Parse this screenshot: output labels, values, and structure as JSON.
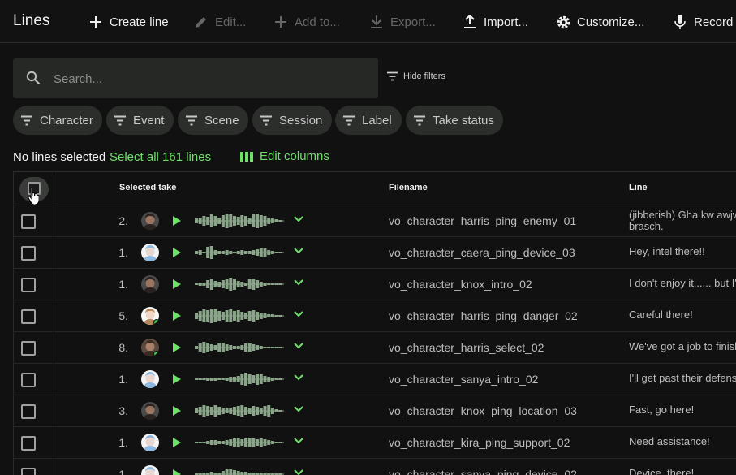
{
  "app": {
    "title": "Lines"
  },
  "toolbar": {
    "create_line": "Create line",
    "edit": "Edit...",
    "add_to": "Add to...",
    "export": "Export...",
    "import": "Import...",
    "customize": "Customize...",
    "record": "Record"
  },
  "search": {
    "placeholder": "Search..."
  },
  "filters": {
    "hide_label": "Hide filters",
    "chips": [
      "Character",
      "Event",
      "Scene",
      "Session",
      "Label",
      "Take status"
    ]
  },
  "selection": {
    "status": "No lines selected",
    "select_all": "Select all 161 lines",
    "edit_columns": "Edit columns"
  },
  "table": {
    "headers": {
      "selected_take": "Selected take",
      "filename": "Filename",
      "line": "Line"
    },
    "rows": [
      {
        "take": "2.",
        "avatar": "male-dark",
        "filename": "vo_character_harris_ping_enemy_01",
        "line": "(jibberish) Gha kw awjw brasch."
      },
      {
        "take": "1.",
        "avatar": "bluehair",
        "filename": "vo_character_caera_ping_device_03",
        "line": "Hey, intel there!!"
      },
      {
        "take": "1.",
        "avatar": "male-dark",
        "filename": "vo_character_knox_intro_02",
        "line": "I don't enjoy it...... but I'm"
      },
      {
        "take": "5.",
        "avatar": "female-light",
        "filename": "vo_character_harris_ping_danger_02",
        "line": "Careful there!"
      },
      {
        "take": "8.",
        "avatar": "male-brown",
        "filename": "vo_character_harris_select_02",
        "line": "We've got a job to finish"
      },
      {
        "take": "1.",
        "avatar": "bluehair",
        "filename": "vo_character_sanya_intro_02",
        "line": "I'll get past their defense"
      },
      {
        "take": "3.",
        "avatar": "male-dark",
        "filename": "vo_character_knox_ping_location_03",
        "line": "Fast, go here!"
      },
      {
        "take": "1.",
        "avatar": "bluehair",
        "filename": "vo_character_kira_ping_support_02",
        "line": "Need assistance!"
      },
      {
        "take": "1.",
        "avatar": "bluehair",
        "filename": "vo_character_sanya_ping_device_02",
        "line": "Device, there!"
      }
    ]
  },
  "colors": {
    "accent": "#6fe06a",
    "background": "#111111",
    "waveform": "#8aa58a"
  }
}
